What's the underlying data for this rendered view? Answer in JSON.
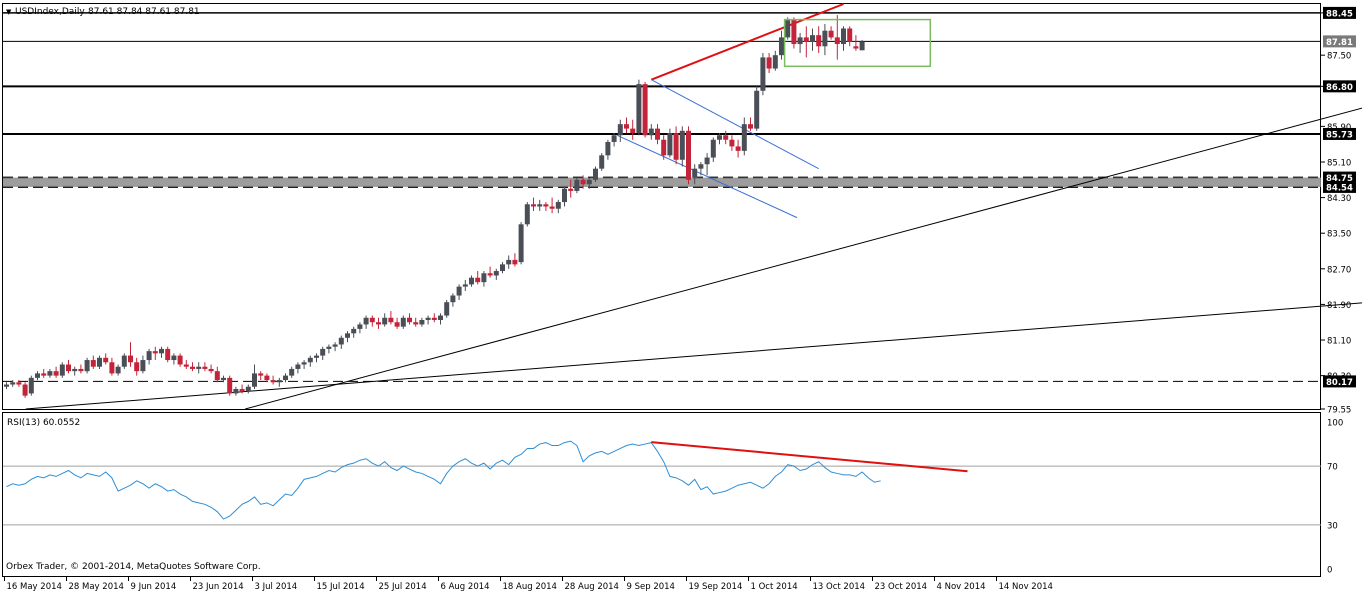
{
  "header": {
    "symbol_label": "USDIndex,Daily",
    "ohlc_text": "87.61 87.84 87.61 87.81"
  },
  "rsi_panel": {
    "label": "RSI(13) 60.0552"
  },
  "copyright": "Orbex Trader, © 2001-2014, MetaQuotes Software Corp.",
  "colors": {
    "bull": "#4a4f57",
    "bear": "#c4243a",
    "rsi_line": "#2f8fd6",
    "trendline_red": "#e01010",
    "channel_blue": "#3b6fd9",
    "range_box": "#7dbb5f"
  },
  "chart_data": [
    {
      "type": "candlestick",
      "ylim": [
        79.55,
        88.65
      ],
      "y_ticks": [
        "88.45",
        "87.50",
        "86.80",
        "85.90",
        "85.10",
        "84.30",
        "83.50",
        "82.70",
        "81.90",
        "81.10",
        "80.30",
        "79.55"
      ],
      "x_labels": [
        "16 May 2014",
        "28 May 2014",
        "9 Jun 2014",
        "23 Jun 2014",
        "3 Jul 2014",
        "15 Jul 2014",
        "25 Jul 2014",
        "6 Aug 2014",
        "18 Aug 2014",
        "28 Aug 2014",
        "9 Sep 2014",
        "19 Sep 2014",
        "1 Oct 2014",
        "13 Oct 2014",
        "23 Oct 2014",
        "4 Nov 2014",
        "14 Nov 2014"
      ],
      "level_tags": [
        "88.45",
        "87.81",
        "86.80",
        "85.73",
        "84.75",
        "84.54",
        "80.17"
      ],
      "candles": [
        [
          80.05,
          80.15,
          80.0,
          80.1
        ],
        [
          80.1,
          80.2,
          80.05,
          80.15
        ],
        [
          80.15,
          80.2,
          80.05,
          80.1
        ],
        [
          80.1,
          80.15,
          79.8,
          79.85
        ],
        [
          79.9,
          80.3,
          79.85,
          80.25
        ],
        [
          80.25,
          80.4,
          80.2,
          80.35
        ],
        [
          80.35,
          80.45,
          80.25,
          80.3
        ],
        [
          80.3,
          80.45,
          80.25,
          80.4
        ],
        [
          80.4,
          80.5,
          80.25,
          80.3
        ],
        [
          80.3,
          80.6,
          80.25,
          80.55
        ],
        [
          80.55,
          80.65,
          80.35,
          80.4
        ],
        [
          80.4,
          80.5,
          80.3,
          80.45
        ],
        [
          80.45,
          80.55,
          80.35,
          80.4
        ],
        [
          80.4,
          80.7,
          80.35,
          80.65
        ],
        [
          80.65,
          80.75,
          80.45,
          80.5
        ],
        [
          80.5,
          80.75,
          80.45,
          80.7
        ],
        [
          80.7,
          80.8,
          80.55,
          80.6
        ],
        [
          80.6,
          80.7,
          80.3,
          80.35
        ],
        [
          80.35,
          80.55,
          80.3,
          80.5
        ],
        [
          80.5,
          80.8,
          80.45,
          80.75
        ],
        [
          80.75,
          81.05,
          80.5,
          80.6
        ],
        [
          80.6,
          80.7,
          80.3,
          80.4
        ],
        [
          80.4,
          80.75,
          80.35,
          80.65
        ],
        [
          80.65,
          80.9,
          80.55,
          80.85
        ],
        [
          80.85,
          80.95,
          80.65,
          80.8
        ],
        [
          80.8,
          80.95,
          80.7,
          80.9
        ],
        [
          80.9,
          80.95,
          80.6,
          80.65
        ],
        [
          80.65,
          80.8,
          80.55,
          80.75
        ],
        [
          80.75,
          80.8,
          80.5,
          80.55
        ],
        [
          80.55,
          80.65,
          80.45,
          80.5
        ],
        [
          80.5,
          80.6,
          80.4,
          80.45
        ],
        [
          80.45,
          80.6,
          80.35,
          80.5
        ],
        [
          80.5,
          80.6,
          80.4,
          80.45
        ],
        [
          80.45,
          80.55,
          80.35,
          80.4
        ],
        [
          80.4,
          80.5,
          80.15,
          80.2
        ],
        [
          80.2,
          80.3,
          80.15,
          80.25
        ],
        [
          80.25,
          80.3,
          79.85,
          79.9
        ],
        [
          79.9,
          80.05,
          79.85,
          80.0
        ],
        [
          80.0,
          80.1,
          79.9,
          79.95
        ],
        [
          79.95,
          80.1,
          79.9,
          80.05
        ],
        [
          80.05,
          80.55,
          80.0,
          80.35
        ],
        [
          80.35,
          80.4,
          80.2,
          80.3
        ],
        [
          80.3,
          80.35,
          80.15,
          80.2
        ],
        [
          80.2,
          80.3,
          80.1,
          80.15
        ],
        [
          80.15,
          80.25,
          80.05,
          80.2
        ],
        [
          80.2,
          80.35,
          80.15,
          80.3
        ],
        [
          80.3,
          80.5,
          80.25,
          80.45
        ],
        [
          80.45,
          80.6,
          80.35,
          80.55
        ],
        [
          80.55,
          80.65,
          80.45,
          80.6
        ],
        [
          80.6,
          80.75,
          80.5,
          80.7
        ],
        [
          80.7,
          80.8,
          80.6,
          80.75
        ],
        [
          80.75,
          80.95,
          80.65,
          80.9
        ],
        [
          80.9,
          81.0,
          80.8,
          80.95
        ],
        [
          80.95,
          81.05,
          80.85,
          81.0
        ],
        [
          81.0,
          81.2,
          80.9,
          81.15
        ],
        [
          81.15,
          81.3,
          81.05,
          81.25
        ],
        [
          81.25,
          81.4,
          81.15,
          81.35
        ],
        [
          81.35,
          81.5,
          81.25,
          81.45
        ],
        [
          81.45,
          81.65,
          81.35,
          81.6
        ],
        [
          81.6,
          81.65,
          81.4,
          81.5
        ],
        [
          81.5,
          81.6,
          81.35,
          81.45
        ],
        [
          81.45,
          81.7,
          81.4,
          81.6
        ],
        [
          81.6,
          81.75,
          81.45,
          81.5
        ],
        [
          81.5,
          81.6,
          81.35,
          81.4
        ],
        [
          81.4,
          81.65,
          81.35,
          81.6
        ],
        [
          81.6,
          81.7,
          81.45,
          81.5
        ],
        [
          81.5,
          81.6,
          81.4,
          81.45
        ],
        [
          81.45,
          81.6,
          81.4,
          81.55
        ],
        [
          81.55,
          81.65,
          81.45,
          81.6
        ],
        [
          81.6,
          81.7,
          81.5,
          81.55
        ],
        [
          81.55,
          81.7,
          81.45,
          81.65
        ],
        [
          81.65,
          82.0,
          81.6,
          81.95
        ],
        [
          81.95,
          82.15,
          81.85,
          82.1
        ],
        [
          82.1,
          82.35,
          82.0,
          82.3
        ],
        [
          82.3,
          82.45,
          82.2,
          82.35
        ],
        [
          82.35,
          82.55,
          82.3,
          82.5
        ],
        [
          82.5,
          82.65,
          82.35,
          82.4
        ],
        [
          82.4,
          82.65,
          82.3,
          82.6
        ],
        [
          82.6,
          82.75,
          82.5,
          82.55
        ],
        [
          82.55,
          82.7,
          82.45,
          82.65
        ],
        [
          82.65,
          82.85,
          82.6,
          82.8
        ],
        [
          82.8,
          83.0,
          82.7,
          82.9
        ],
        [
          82.9,
          83.05,
          82.75,
          82.8
        ],
        [
          82.85,
          83.75,
          82.8,
          83.7
        ],
        [
          83.7,
          84.2,
          83.65,
          84.15
        ],
        [
          84.15,
          84.3,
          84.0,
          84.1
        ],
        [
          84.1,
          84.25,
          84.0,
          84.15
        ],
        [
          84.15,
          84.2,
          84.0,
          84.1
        ],
        [
          84.1,
          84.3,
          83.95,
          84.05
        ],
        [
          84.05,
          84.25,
          83.95,
          84.2
        ],
        [
          84.2,
          84.55,
          84.1,
          84.5
        ],
        [
          84.5,
          84.7,
          84.3,
          84.45
        ],
        [
          84.45,
          84.75,
          84.4,
          84.7
        ],
        [
          84.7,
          84.8,
          84.5,
          84.6
        ],
        [
          84.6,
          84.75,
          84.5,
          84.7
        ],
        [
          84.7,
          85.0,
          84.65,
          84.95
        ],
        [
          84.95,
          85.3,
          84.9,
          85.25
        ],
        [
          85.25,
          85.6,
          85.15,
          85.55
        ],
        [
          85.55,
          85.75,
          85.45,
          85.7
        ],
        [
          85.7,
          86.05,
          85.55,
          85.95
        ],
        [
          85.95,
          86.1,
          85.75,
          85.85
        ],
        [
          85.85,
          86.05,
          85.6,
          85.75
        ],
        [
          85.75,
          86.95,
          85.7,
          86.85
        ],
        [
          86.85,
          86.9,
          85.65,
          85.7
        ],
        [
          85.7,
          85.95,
          85.6,
          85.85
        ],
        [
          85.85,
          85.95,
          85.5,
          85.6
        ],
        [
          85.6,
          85.7,
          85.15,
          85.25
        ],
        [
          85.25,
          85.85,
          85.2,
          85.75
        ],
        [
          85.75,
          85.9,
          85.05,
          85.15
        ],
        [
          85.15,
          85.9,
          85.0,
          85.8
        ],
        [
          85.8,
          85.9,
          84.6,
          84.7
        ],
        [
          84.75,
          85.05,
          84.6,
          84.95
        ],
        [
          84.95,
          85.1,
          84.8,
          85.05
        ],
        [
          85.05,
          85.3,
          84.8,
          85.2
        ],
        [
          85.2,
          85.65,
          85.1,
          85.6
        ],
        [
          85.6,
          85.75,
          85.5,
          85.7
        ],
        [
          85.7,
          85.8,
          85.5,
          85.6
        ],
        [
          85.6,
          85.7,
          85.35,
          85.45
        ],
        [
          85.45,
          85.6,
          85.2,
          85.35
        ],
        [
          85.35,
          86.1,
          85.25,
          85.95
        ],
        [
          85.95,
          86.1,
          85.8,
          85.85
        ],
        [
          85.85,
          86.8,
          85.8,
          86.7
        ],
        [
          86.7,
          87.55,
          86.6,
          87.45
        ],
        [
          87.45,
          87.55,
          87.1,
          87.2
        ],
        [
          87.2,
          87.6,
          87.15,
          87.5
        ],
        [
          87.5,
          88.05,
          87.4,
          87.9
        ],
        [
          87.9,
          88.35,
          87.85,
          88.3
        ],
        [
          88.3,
          88.35,
          87.65,
          87.75
        ],
        [
          87.75,
          88.0,
          87.55,
          87.9
        ],
        [
          87.9,
          88.15,
          87.45,
          87.8
        ],
        [
          87.8,
          88.1,
          87.6,
          87.95
        ],
        [
          87.95,
          88.15,
          87.55,
          87.7
        ],
        [
          87.7,
          88.2,
          87.5,
          88.05
        ],
        [
          88.05,
          88.15,
          87.85,
          87.9
        ],
        [
          87.9,
          88.4,
          87.4,
          87.75
        ],
        [
          87.75,
          88.15,
          87.6,
          88.1
        ],
        [
          88.1,
          88.15,
          87.7,
          87.8
        ],
        [
          87.7,
          87.95,
          87.6,
          87.65
        ],
        [
          87.61,
          87.84,
          87.61,
          87.81
        ]
      ],
      "horizontal_levels": [
        {
          "name": "resistance-88-45",
          "value": 88.45,
          "style": "solid",
          "width": 1.5
        },
        {
          "name": "current-price-87-81",
          "value": 87.81,
          "style": "solid",
          "width": 1
        },
        {
          "name": "level-86-80",
          "value": 86.8,
          "style": "solid",
          "width": 2
        },
        {
          "name": "level-85-73",
          "value": 85.73,
          "style": "solid",
          "width": 2
        },
        {
          "name": "level-84-75",
          "value": 84.75,
          "style": "dashed",
          "width": 2
        },
        {
          "name": "level-84-54",
          "value": 84.54,
          "style": "dashed",
          "width": 2
        },
        {
          "name": "level-80-17",
          "value": 80.17,
          "style": "dashed",
          "width": 1
        }
      ],
      "trendlines": [
        {
          "name": "long-term-uptrend",
          "color": "black",
          "from": [
            3.1,
            79.55
          ],
          "to": [
            221,
            81.96
          ]
        },
        {
          "name": "medium-uptrend",
          "color": "black",
          "from": [
            38.5,
            79.55
          ],
          "to": [
            221,
            86.4
          ]
        },
        {
          "name": "upper-red-channel",
          "color": "red",
          "from": [
            104,
            86.95
          ],
          "to": [
            135,
            88.65
          ]
        },
        {
          "name": "blue-channel-top",
          "color": "blue",
          "from": [
            104,
            86.95
          ],
          "to": [
            131,
            84.95
          ]
        },
        {
          "name": "blue-channel-bottom",
          "color": "blue",
          "from": [
            98.5,
            85.7
          ],
          "to": [
            127.5,
            83.85
          ]
        }
      ],
      "range_box": {
        "x_from": 125.5,
        "x_to": 149,
        "y_low": 87.25,
        "y_high": 88.3
      }
    },
    {
      "type": "line",
      "name": "RSI(13)",
      "ylim": [
        0,
        100
      ],
      "y_ticks": [
        "100",
        "70",
        "30",
        "0"
      ],
      "reference_levels": [
        70,
        30
      ],
      "values": [
        56,
        58,
        57,
        58,
        61,
        63,
        62,
        64,
        63,
        65,
        67,
        64,
        62,
        65,
        64,
        63,
        66,
        62,
        53,
        55,
        57,
        60,
        58,
        55,
        58,
        56,
        53,
        54,
        51,
        49,
        46,
        45,
        44,
        42,
        39,
        34,
        36,
        40,
        44,
        46,
        49,
        44,
        45,
        43,
        47,
        51,
        50,
        55,
        61,
        62,
        63,
        65,
        67,
        66,
        69,
        71,
        72,
        74,
        75,
        72,
        70,
        73,
        69,
        67,
        70,
        68,
        66,
        65,
        63,
        61,
        58,
        65,
        70,
        73,
        75,
        72,
        70,
        72,
        68,
        72,
        74,
        71,
        76,
        78,
        82,
        82,
        85,
        86,
        84,
        84,
        86,
        87,
        84,
        73,
        77,
        79,
        80,
        78,
        80,
        82,
        84,
        85,
        84,
        85,
        86,
        80,
        73,
        63,
        62,
        60,
        57,
        61,
        54,
        56,
        51,
        52,
        53,
        55,
        57,
        58,
        59,
        57,
        55,
        58,
        63,
        66,
        71,
        70,
        67,
        68,
        71,
        73,
        69,
        66,
        65,
        64,
        64,
        63,
        66,
        62,
        59,
        60
      ],
      "divergence_line": {
        "from": [
          104,
          86.3
        ],
        "to": [
          155,
          66.5
        ]
      }
    }
  ]
}
